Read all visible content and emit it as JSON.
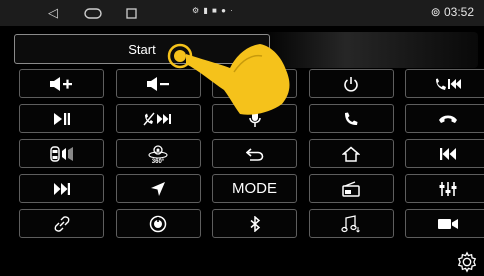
{
  "status_bar": {
    "time": "03:52",
    "nav_icons": [
      "back-icon",
      "home-icon",
      "recents-icon"
    ],
    "notification_icons": "⚙ ▮ ■ ● ·"
  },
  "start_button": {
    "label": "Start"
  },
  "keys": [
    {
      "icon": "volume-up-icon",
      "label": ""
    },
    {
      "icon": "volume-down-icon",
      "label": ""
    },
    {
      "icon": "mute-icon",
      "label": ""
    },
    {
      "icon": "power-icon",
      "label": ""
    },
    {
      "icon": "call-previous-icon",
      "label": ""
    },
    {
      "icon": "play-pause-icon",
      "label": ""
    },
    {
      "icon": "mute-next-icon",
      "label": ""
    },
    {
      "icon": "microphone-icon",
      "label": ""
    },
    {
      "icon": "phone-answer-icon",
      "label": ""
    },
    {
      "icon": "phone-hangup-icon",
      "label": ""
    },
    {
      "icon": "car-speaker-icon",
      "label": ""
    },
    {
      "icon": "camera-360-icon",
      "label": ""
    },
    {
      "icon": "return-icon",
      "label": ""
    },
    {
      "icon": "home-outline-icon",
      "label": ""
    },
    {
      "icon": "skip-previous-icon",
      "label": ""
    },
    {
      "icon": "skip-next-icon",
      "label": ""
    },
    {
      "icon": "navigation-arrow-icon",
      "label": ""
    },
    {
      "icon": "mode-text",
      "label": "MODE"
    },
    {
      "icon": "radio-icon",
      "label": ""
    },
    {
      "icon": "equalizer-icon",
      "label": ""
    },
    {
      "icon": "link-icon",
      "label": ""
    },
    {
      "icon": "dial-icon",
      "label": ""
    },
    {
      "icon": "bluetooth-icon",
      "label": ""
    },
    {
      "icon": "music-icon",
      "label": ""
    },
    {
      "icon": "video-camera-icon",
      "label": ""
    }
  ],
  "colors": {
    "hand": "#f5c21b",
    "key_border": "#5e5e5e",
    "background": "#000000"
  },
  "settings_icon": "gear-icon"
}
